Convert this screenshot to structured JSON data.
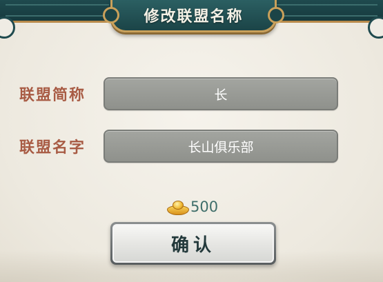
{
  "dialog": {
    "title": "修改联盟名称"
  },
  "form": {
    "abbrev_label": "联盟简称",
    "abbrev_value": "长",
    "name_label": "联盟名字",
    "name_value": "长山俱乐部"
  },
  "cost": {
    "icon": "gold-ingot-icon",
    "amount": "500"
  },
  "confirm_button": {
    "label": "确认"
  },
  "colors": {
    "frame": "#1f4a4e",
    "label": "#a85b44",
    "cost_text": "#3f6e6a",
    "field_bg": "#999b96"
  }
}
